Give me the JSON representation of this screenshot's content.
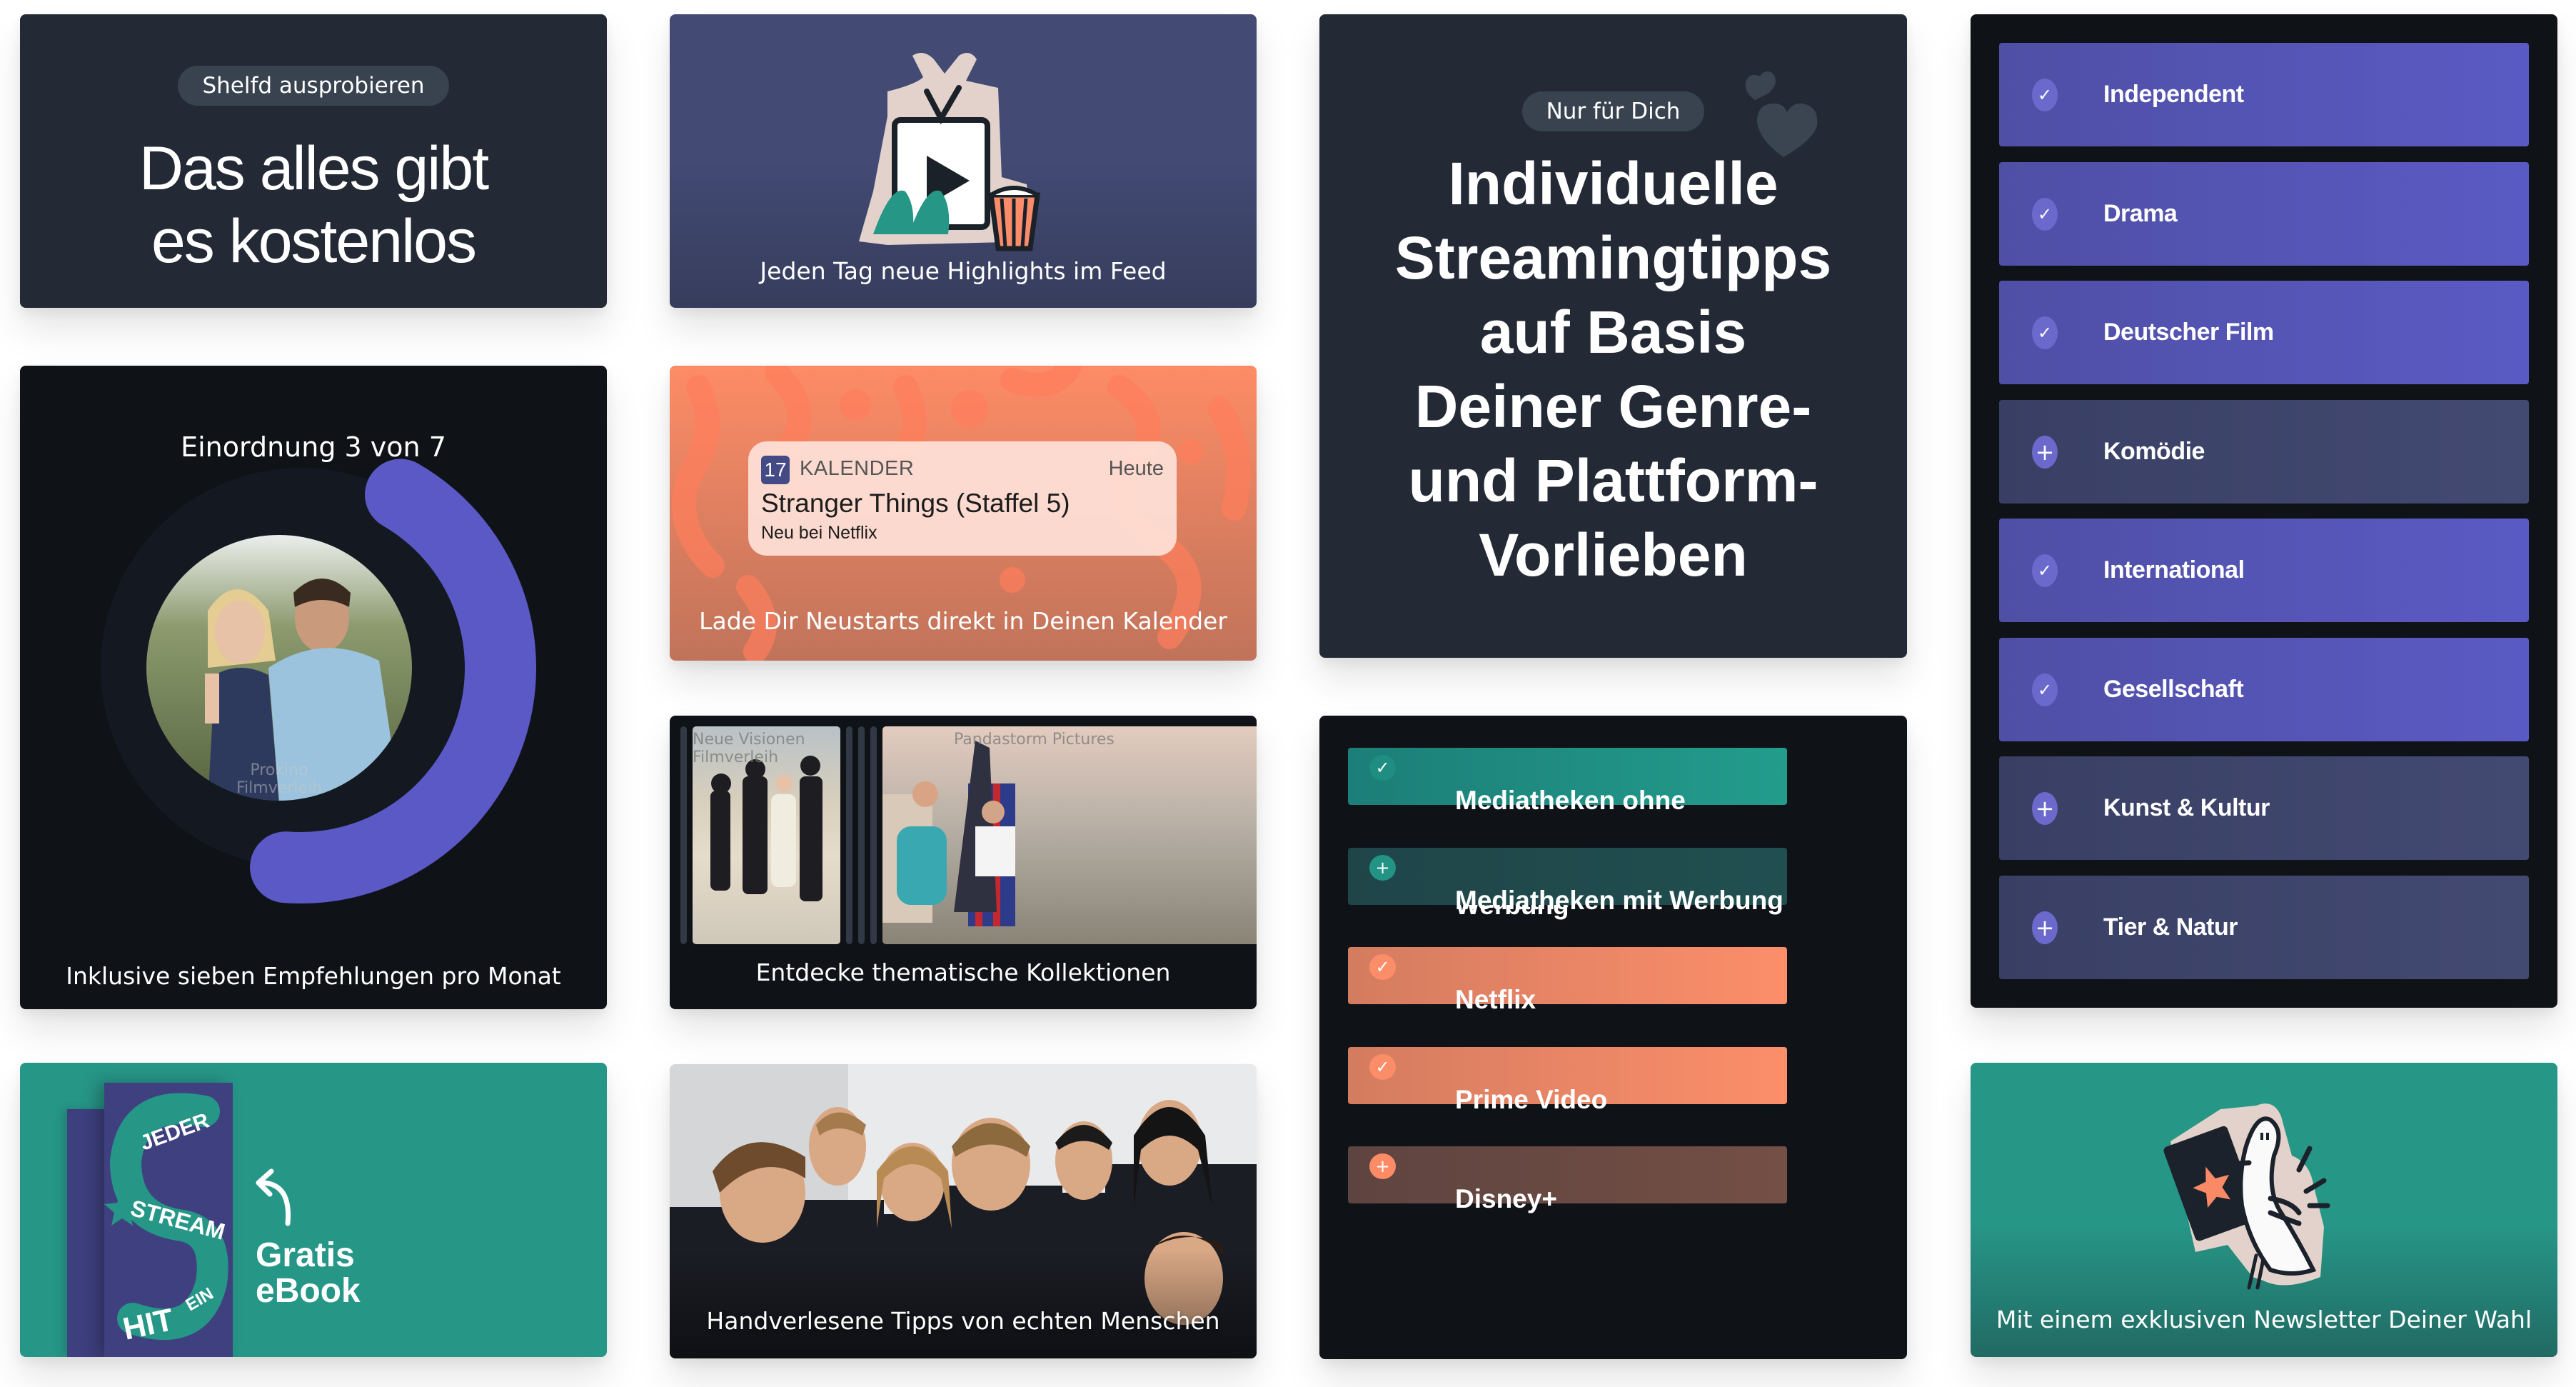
{
  "colors": {
    "dark": "#232a35",
    "black": "#0f1217",
    "purple": "#5a5ac4",
    "purple_muted": "#3f456c",
    "teal": "#269686",
    "teal_dark": "#214d4d",
    "coral": "#fd8c66",
    "brown": "#6b4a42"
  },
  "free_card": {
    "pill": "Shelfd ausprobieren",
    "headline_line1": "Das alles gibt",
    "headline_line2": "es kostenlos"
  },
  "feed_card": {
    "icon": "tv-popcorn-sticker",
    "caption": "Jeden Tag neue Highlights im Feed"
  },
  "personal_card": {
    "pill": "Nur für Dich",
    "icon": "hearts",
    "headline_lines": [
      "Individuelle",
      "Streamingtipps",
      "auf Basis",
      "Deiner Genre-",
      "und Plattform-",
      "Vorlieben"
    ]
  },
  "genres": {
    "items": [
      {
        "label": "Independent",
        "selected": true,
        "icon": "check-icon"
      },
      {
        "label": "Drama",
        "selected": true,
        "icon": "check-icon"
      },
      {
        "label": "Deutscher Film",
        "selected": true,
        "icon": "check-icon"
      },
      {
        "label": "Komödie",
        "selected": false,
        "icon": "plus-icon"
      },
      {
        "label": "International",
        "selected": true,
        "icon": "check-icon"
      },
      {
        "label": "Gesellschaft",
        "selected": true,
        "icon": "check-icon"
      },
      {
        "label": "Kunst & Kultur",
        "selected": false,
        "icon": "plus-icon"
      },
      {
        "label": "Tier & Natur",
        "selected": false,
        "icon": "plus-icon"
      }
    ]
  },
  "rank_card": {
    "title": "Einordnung 3 von 7",
    "progress": {
      "current": 3,
      "total": 7
    },
    "photo_credit": "Prokino Filmverleih",
    "caption": "Inklusive sieben Empfehlungen pro Monat"
  },
  "calendar_card": {
    "notification": {
      "app_icon_text": "17",
      "app_name": "KALENDER",
      "time": "Heute",
      "title": "Stranger Things (Staffel 5)",
      "subtitle": "Neu bei Netflix"
    },
    "caption": "Lade Dir Neustarts direkt in Deinen Kalender"
  },
  "collections_card": {
    "posters": [
      {
        "credit": "Neue Visionen Filmverleih"
      },
      {
        "credit": "Pandastorm Pictures"
      }
    ],
    "caption": "Entdecke thematische Kollektionen"
  },
  "platforms": {
    "items": [
      {
        "label": "Mediatheken ohne Werbung",
        "selected": true,
        "icon": "check-icon",
        "theme": "teal"
      },
      {
        "label": "Mediatheken mit Werbung",
        "selected": false,
        "icon": "plus-icon",
        "theme": "teal"
      },
      {
        "label": "Netflix",
        "selected": true,
        "icon": "check-icon",
        "theme": "coral"
      },
      {
        "label": "Prime Video",
        "selected": true,
        "icon": "check-icon",
        "theme": "coral"
      },
      {
        "label": "Disney+",
        "selected": false,
        "icon": "plus-icon",
        "theme": "coral"
      }
    ]
  },
  "ebook_card": {
    "book_words": [
      "JEDER",
      "STREAM",
      "EIN",
      "HIT"
    ],
    "label_line1": "Gratis",
    "label_line2": "eBook"
  },
  "people_card": {
    "caption": "Handverlesene Tipps von echten Menschen"
  },
  "newsletter_card": {
    "icon": "pigeon-letter-sticker",
    "caption": "Mit einem exklusiven Newsletter Deiner Wahl"
  }
}
